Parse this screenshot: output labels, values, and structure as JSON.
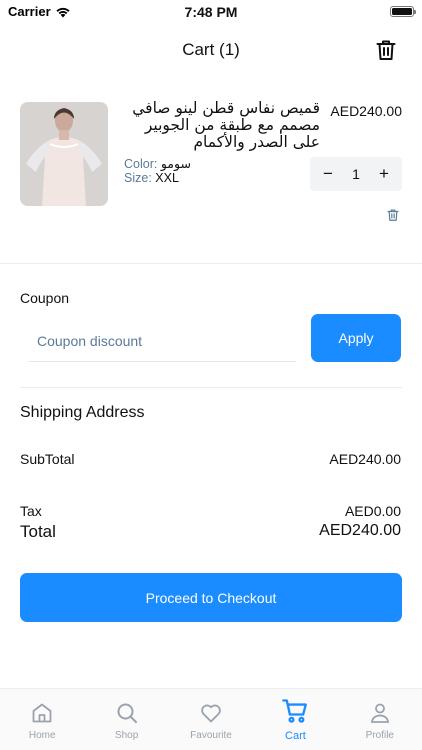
{
  "status_bar": {
    "carrier": "Carrier",
    "time": "7:48 PM",
    "battery_level": 1.0
  },
  "nav": {
    "title": "Cart (1)",
    "trash_icon": "trash-icon"
  },
  "cart_items": [
    {
      "name": "قميص نفاس قطن لينو صافي مصمم مع طبقة من الجوبير على الصدر والأكمام",
      "price": "AED240.00",
      "color_label": "Color:",
      "color_value": "سومو",
      "size_label": "Size:",
      "size_value": "XXL",
      "quantity": "1",
      "minus_glyph": "−",
      "plus_glyph": "+"
    }
  ],
  "coupon": {
    "label": "Coupon",
    "placeholder": "Coupon discount",
    "value": "",
    "apply_label": "Apply"
  },
  "summary": {
    "shipping_title": "Shipping Address",
    "subtotal_label": "SubTotal",
    "subtotal_value": "AED240.00",
    "tax_label": "Tax",
    "tax_value": "AED0.00",
    "total_label": "Total",
    "total_value": "AED240.00"
  },
  "checkout": {
    "label": "Proceed to Checkout"
  },
  "tab_bar": {
    "tabs": [
      {
        "label": "Home",
        "icon": "home-icon",
        "active": false
      },
      {
        "label": "Shop",
        "icon": "search-icon",
        "active": false
      },
      {
        "label": "Favourite",
        "icon": "heart-icon",
        "active": false
      },
      {
        "label": "Cart",
        "icon": "cart-icon",
        "active": true
      },
      {
        "label": "Profile",
        "icon": "profile-icon",
        "active": false
      }
    ]
  },
  "colors": {
    "accent": "#1a8cff",
    "muted_label": "#5b7a99",
    "inactive_tab": "#9aa3ad"
  }
}
